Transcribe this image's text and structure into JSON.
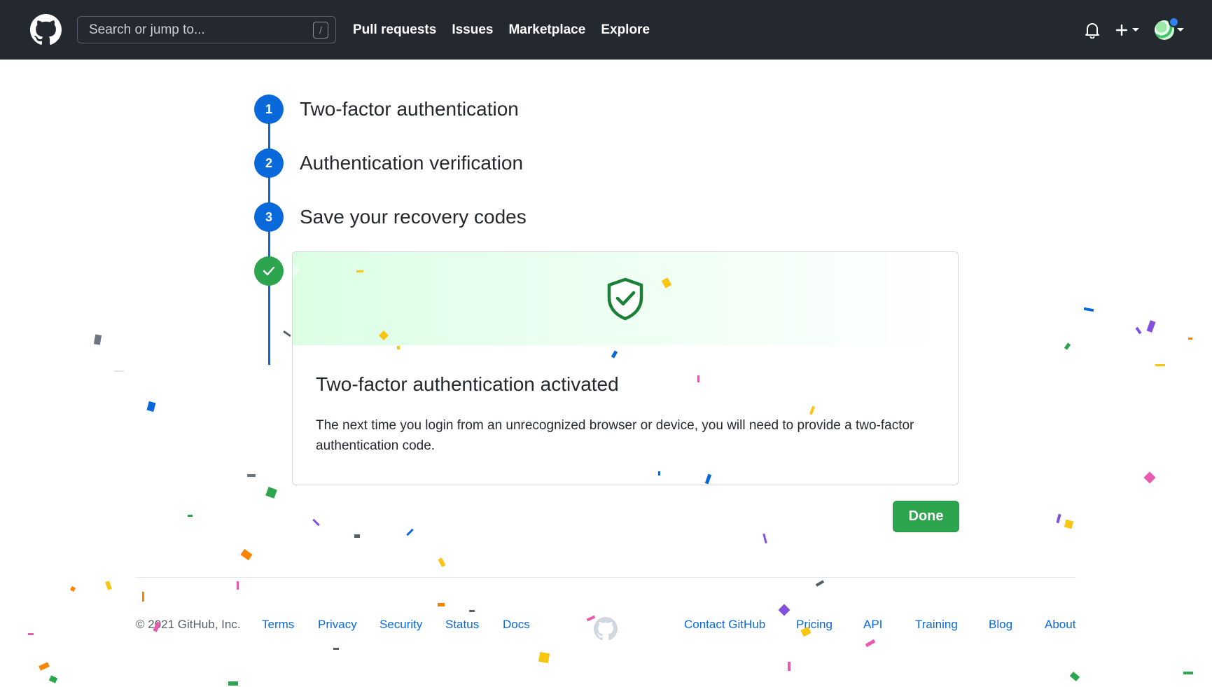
{
  "header": {
    "search": {
      "placeholder": "Search or jump to...",
      "shortcut_key": "/"
    },
    "nav": [
      "Pull requests",
      "Issues",
      "Marketplace",
      "Explore"
    ],
    "icons": [
      "github-logo-icon",
      "bell-icon",
      "plus-icon",
      "avatar"
    ]
  },
  "steps": [
    {
      "number": "1",
      "title": "Two-factor authentication"
    },
    {
      "number": "2",
      "title": "Authentication verification"
    },
    {
      "number": "3",
      "title": "Save your recovery codes"
    },
    {
      "number": "",
      "title": ""
    }
  ],
  "card": {
    "title": "Two-factor authentication activated",
    "text": "The next time you login from an unrecognized browser or device, you will need to provide a two-factor authentication code."
  },
  "done_button": "Done",
  "footer": {
    "copyright": "© 2021 GitHub, Inc.",
    "left_links": [
      "Terms",
      "Privacy",
      "Security",
      "Status",
      "Docs"
    ],
    "right_links": [
      "Contact GitHub",
      "Pricing",
      "API",
      "Training",
      "Blog",
      "About"
    ]
  },
  "colors": {
    "header_bg": "#24292f",
    "step_blue": "#0969da",
    "success_green": "#2da44e",
    "link_blue": "#0969da"
  }
}
